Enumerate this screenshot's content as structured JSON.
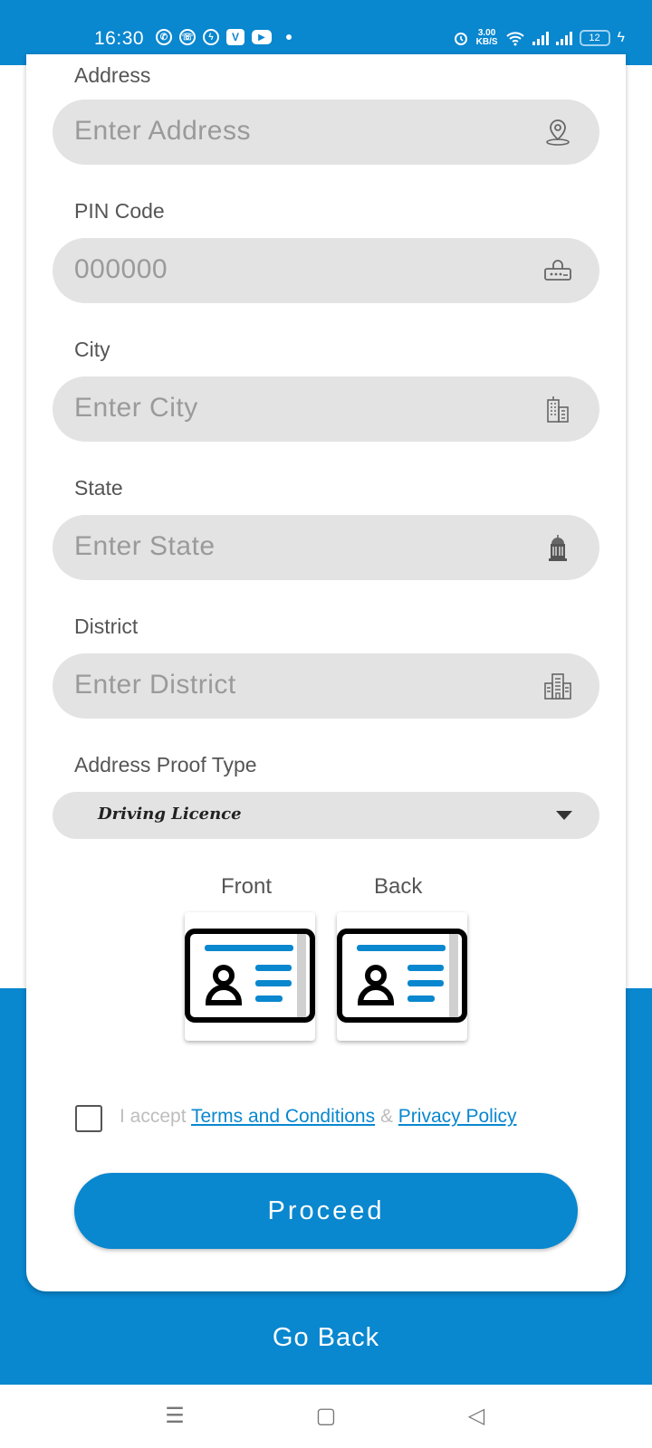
{
  "status_bar": {
    "time": "16:30",
    "speed_top": "3.00",
    "speed_bottom": "KB/S",
    "battery": "12",
    "left_icons": [
      "whatsapp-icon",
      "viber-icon",
      "messenger-icon",
      "vimeo-icon",
      "youtube-icon"
    ],
    "right_icons": [
      "alarm-icon",
      "wifi-icon",
      "signal-icon",
      "signal-icon",
      "battery-icon",
      "charging-icon"
    ]
  },
  "form": {
    "address": {
      "label": "Address",
      "placeholder": "Enter Address",
      "icon": "location-pin-icon"
    },
    "pin": {
      "label": "PIN Code",
      "placeholder": "000000",
      "icon": "lock-password-icon"
    },
    "city": {
      "label": "City",
      "placeholder": "Enter City",
      "icon": "city-buildings-icon"
    },
    "state": {
      "label": "State",
      "placeholder": "Enter State",
      "icon": "state-building-icon"
    },
    "district": {
      "label": "District",
      "placeholder": "Enter District",
      "icon": "district-building-icon"
    },
    "proof": {
      "label": "Address Proof Type",
      "selected": "Driving Licence"
    }
  },
  "upload": {
    "front_label": "Front",
    "back_label": "Back",
    "icon": "id-card-icon"
  },
  "terms": {
    "prefix": "I accept ",
    "terms_link": "Terms and Conditions",
    "joiner": " & ",
    "privacy_link": "Privacy Policy"
  },
  "actions": {
    "proceed": "Proceed",
    "go_back": "Go Back"
  },
  "nav": {
    "menu": "☰",
    "home": "▢",
    "back": "◁"
  },
  "colors": {
    "primary": "#0987cf",
    "field_bg": "#e3e3e3",
    "label": "#555555",
    "placeholder": "#9a9a9a"
  }
}
